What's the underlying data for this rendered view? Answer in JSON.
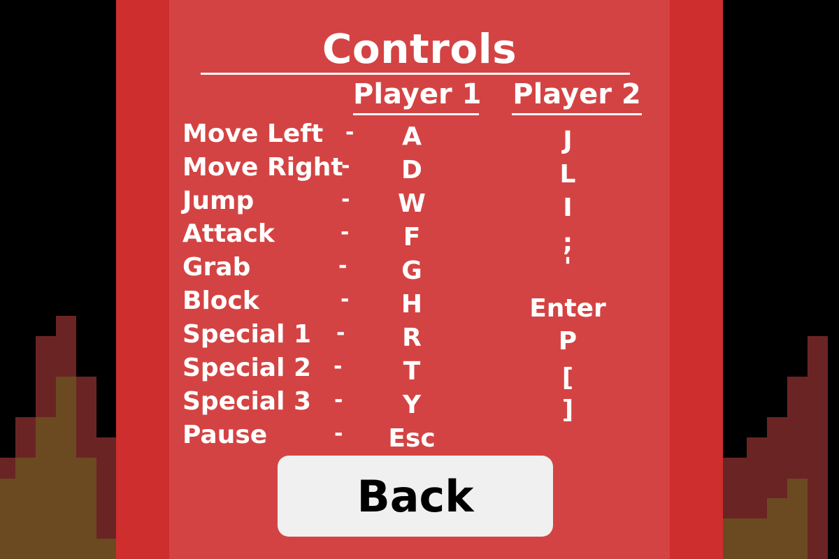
{
  "screen": {
    "title": "Controls",
    "columns": {
      "player1": "Player 1",
      "player2": "Player 2"
    },
    "actions": [
      {
        "label": "Move Left",
        "separator": "-",
        "player1": "A"
      },
      {
        "label": "Move Right",
        "separator": "-",
        "player1": "D"
      },
      {
        "label": "Jump",
        "separator": "-",
        "player1": "W"
      },
      {
        "label": "Attack",
        "separator": "-",
        "player1": "F"
      },
      {
        "label": "Grab",
        "separator": "-",
        "player1": "G"
      },
      {
        "label": "Block",
        "separator": "-",
        "player1": "H"
      },
      {
        "label": "Special 1",
        "separator": "-",
        "player1": "R"
      },
      {
        "label": "Special 2",
        "separator": "-",
        "player1": "T"
      },
      {
        "label": "Special 3",
        "separator": "-",
        "player1": "Y"
      },
      {
        "label": "Pause",
        "separator": "-",
        "player1": "Esc"
      }
    ],
    "player2_keys": [
      "J",
      "L",
      "I",
      ";",
      "'",
      "Enter",
      "P",
      "[",
      "]"
    ],
    "back_label": "Back"
  },
  "colors": {
    "background": "#000000",
    "panel_outer": "#cf2e2e",
    "panel_inner": "#d44343",
    "flame_outer": "#6b2424",
    "flame_inner": "#6b4a22",
    "text": "#ffffff",
    "button": "#f0f0f0"
  }
}
